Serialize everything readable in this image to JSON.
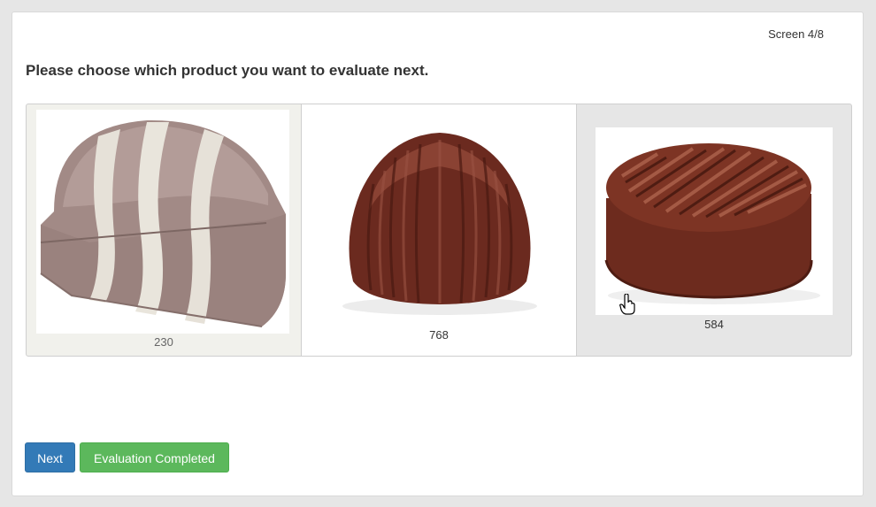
{
  "header": {
    "screen_counter": "Screen 4/8"
  },
  "prompt": "Please choose which product you want to evaluate next.",
  "products": [
    {
      "code": "230",
      "image": "marbled-milk-chocolate-praline-image",
      "selected": false
    },
    {
      "code": "768",
      "image": "ribbed-dark-chocolate-cup-image",
      "selected": false
    },
    {
      "code": "584",
      "image": "round-chocolate-with-ridged-top-image",
      "selected": true
    }
  ],
  "buttons": {
    "next": "Next",
    "evaluation_completed": "Evaluation Completed"
  },
  "colors": {
    "next": "#337ab7",
    "completed": "#5cb85c",
    "selected_card": "#e6e6e6"
  }
}
